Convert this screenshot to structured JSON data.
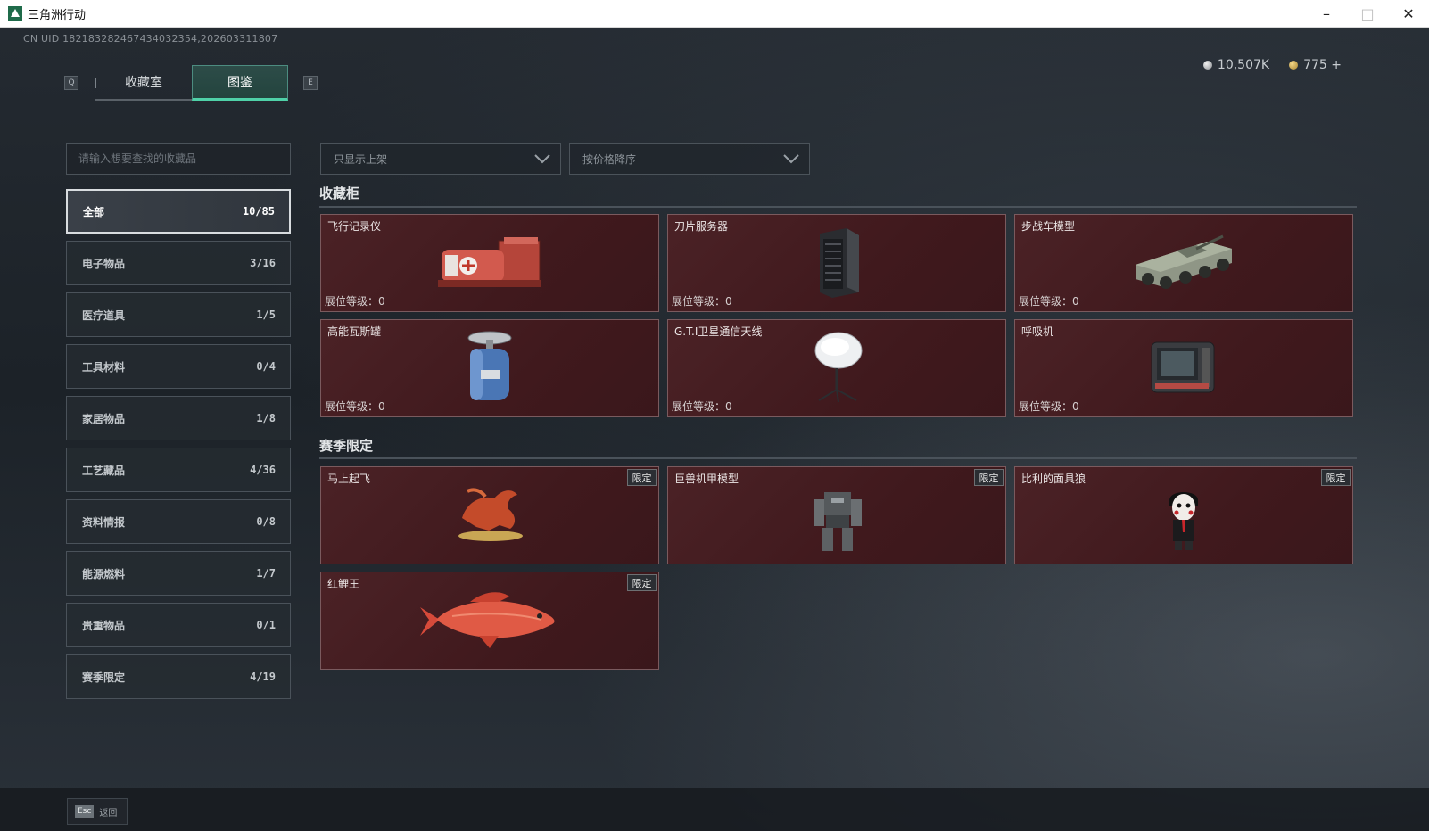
{
  "window": {
    "title": "三角洲行动"
  },
  "header": {
    "uid": "CN UID 182183282467434032354,202603311807",
    "key_left": "Q",
    "key_right": "E",
    "tabs": [
      {
        "label": "收藏室"
      },
      {
        "label": "图鉴"
      }
    ],
    "currency": {
      "silver": "10,507K",
      "gold": "775 +"
    }
  },
  "search": {
    "placeholder": "请输入想要查找的收藏品"
  },
  "filters": {
    "listing": "只显示上架",
    "sort": "按价格降序"
  },
  "categories": [
    {
      "label": "全部",
      "count": "10/85"
    },
    {
      "label": "电子物品",
      "count": "3/16"
    },
    {
      "label": "医疗道具",
      "count": "1/5"
    },
    {
      "label": "工具材料",
      "count": "0/4"
    },
    {
      "label": "家居物品",
      "count": "1/8"
    },
    {
      "label": "工艺藏品",
      "count": "4/36"
    },
    {
      "label": "资料情报",
      "count": "0/8"
    },
    {
      "label": "能源燃料",
      "count": "1/7"
    },
    {
      "label": "贵重物品",
      "count": "0/1"
    },
    {
      "label": "赛季限定",
      "count": "4/19"
    }
  ],
  "sections": {
    "cabinet": {
      "title": "收藏柜",
      "level_label": "展位等级：",
      "items": [
        {
          "name": "飞行记录仪",
          "level": "0",
          "icon": "flight-recorder-icon"
        },
        {
          "name": "刀片服务器",
          "level": "0",
          "icon": "blade-server-icon"
        },
        {
          "name": "步战车模型",
          "level": "0",
          "icon": "ifv-model-icon"
        },
        {
          "name": "高能瓦斯罐",
          "level": "0",
          "icon": "gas-canister-icon"
        },
        {
          "name": "G.T.I卫星通信天线",
          "level": "0",
          "icon": "satellite-antenna-icon"
        },
        {
          "name": "呼吸机",
          "level": "0",
          "icon": "ventilator-icon"
        }
      ]
    },
    "season": {
      "title": "赛季限定",
      "badge": "限定",
      "items": [
        {
          "name": "马上起飞",
          "icon": "horse-statue-icon"
        },
        {
          "name": "巨兽机甲模型",
          "icon": "mech-model-icon"
        },
        {
          "name": "比利的面具狼",
          "icon": "billy-puppet-icon"
        },
        {
          "name": "红鲤王",
          "icon": "red-carp-icon"
        }
      ]
    }
  },
  "footer": {
    "esc_key": "Esc",
    "esc_label": "返回"
  }
}
